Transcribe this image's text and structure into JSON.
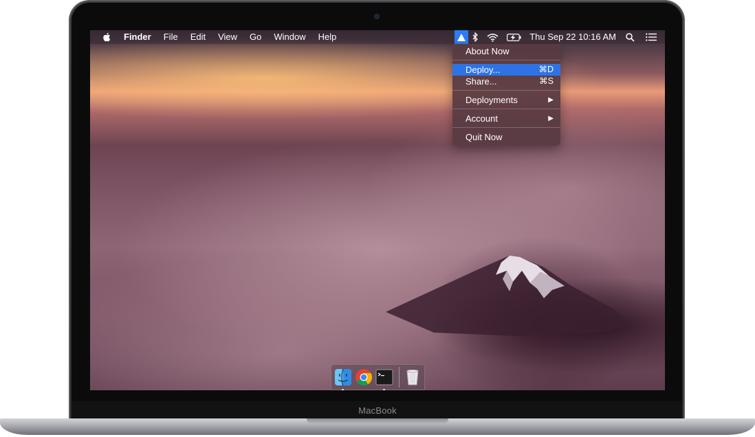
{
  "device": {
    "label": "MacBook"
  },
  "menubar": {
    "apple_icon": "apple-logo-icon",
    "items": [
      {
        "label": "Finder",
        "bold": true
      },
      {
        "label": "File"
      },
      {
        "label": "Edit"
      },
      {
        "label": "View"
      },
      {
        "label": "Go"
      },
      {
        "label": "Window"
      },
      {
        "label": "Help"
      }
    ],
    "status": {
      "app_icon": "now-triangle-icon",
      "bluetooth_icon": "bluetooth-icon",
      "wifi_icon": "wifi-icon",
      "battery_icon": "battery-charging-icon",
      "clock": "Thu Sep 22  10:16 AM",
      "spotlight_icon": "search-icon",
      "notification_icon": "list-icon"
    }
  },
  "dropdown": {
    "about": "About Now",
    "deploy": {
      "label": "Deploy...",
      "shortcut": "⌘D"
    },
    "share": {
      "label": "Share...",
      "shortcut": "⌘S"
    },
    "deployments": "Deployments",
    "account": "Account",
    "quit": "Quit Now",
    "submenu_arrow": "▶",
    "highlight_color": "#2e73e6"
  },
  "dock": {
    "apps": [
      {
        "name": "Finder",
        "icon": "finder-icon",
        "running": true
      },
      {
        "name": "Chrome",
        "icon": "chrome-icon",
        "running": false
      },
      {
        "name": "Terminal",
        "icon": "terminal-icon",
        "running": true
      },
      {
        "name": "Trash",
        "icon": "trash-icon",
        "running": false
      }
    ]
  },
  "colors": {
    "accent": "#2d7cf6"
  }
}
